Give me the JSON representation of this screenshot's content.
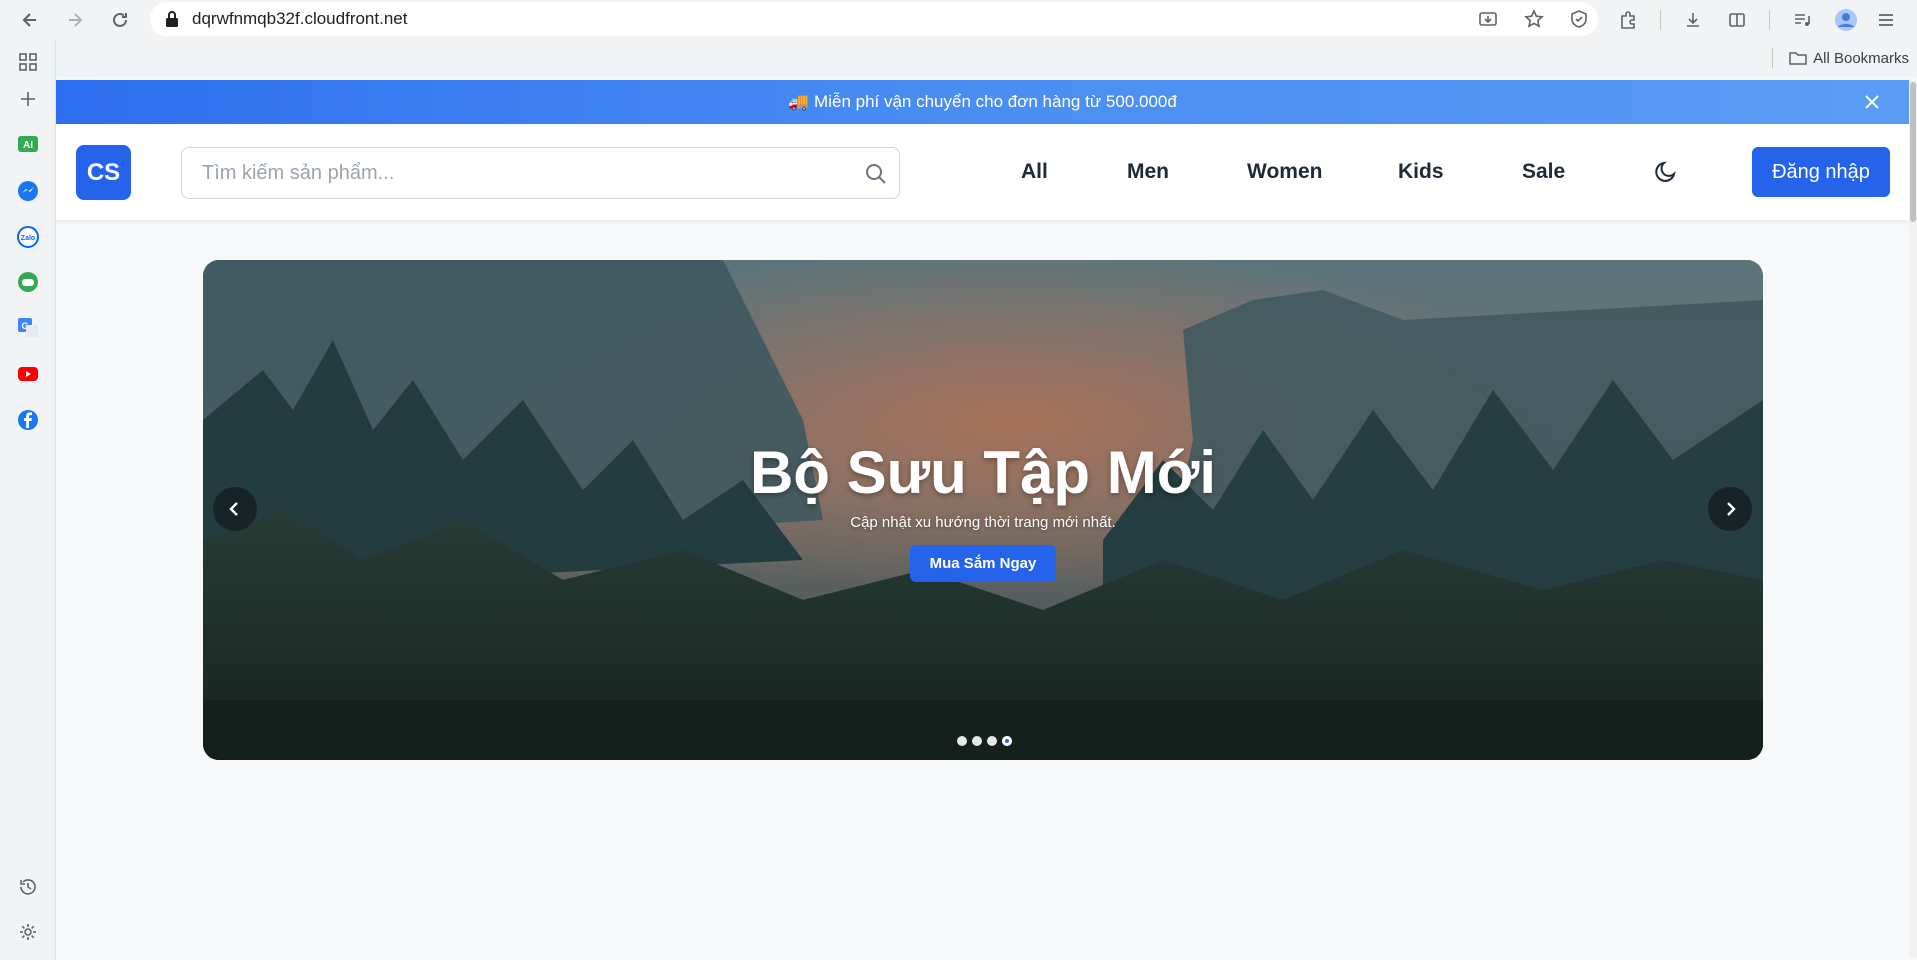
{
  "browser": {
    "url": "dqrwfnmqb32f.cloudfront.net",
    "bookmarks_label": "All Bookmarks"
  },
  "promo": {
    "text": "🚚 Miễn phí vận chuyển cho đơn hàng từ 500.000đ"
  },
  "header": {
    "logo": "CS",
    "search_placeholder": "Tìm kiếm sản phẩm...",
    "nav": [
      "All",
      "Men",
      "Women",
      "Kids",
      "Sale"
    ],
    "login_label": "Đăng nhập",
    "accent": "#2563eb"
  },
  "hero": {
    "title": "Bộ Sưu Tập Mới",
    "subtitle": "Cập nhật xu hướng thời trang mới nhất.",
    "cta": "Mua Sắm Ngay",
    "slides_total": 4,
    "active_slide": 4
  },
  "sidebar_icons": [
    "apps-icon",
    "new-tab-icon",
    "ai-icon",
    "messenger-icon",
    "zalo-icon",
    "games-icon",
    "translate-icon",
    "youtube-icon",
    "facebook-icon",
    "history-icon",
    "settings-icon"
  ]
}
